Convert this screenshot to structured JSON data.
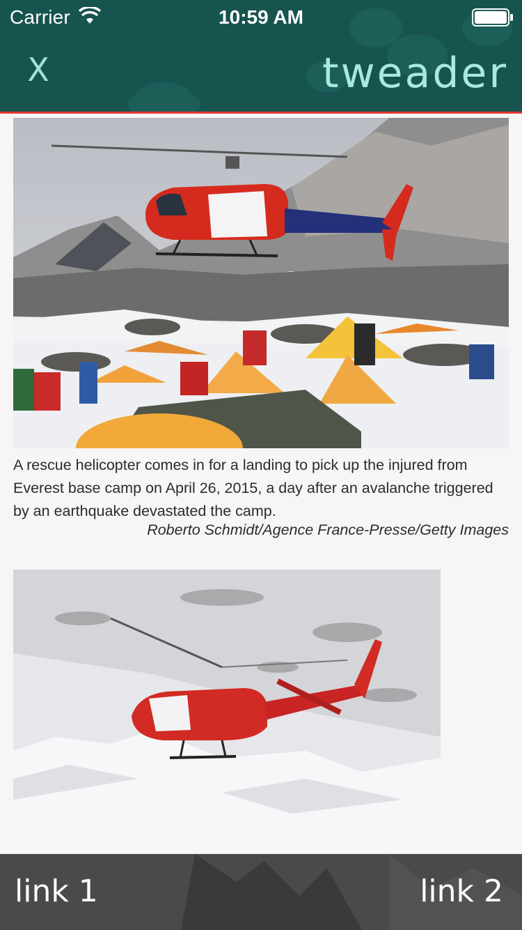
{
  "status_bar": {
    "carrier": "Carrier",
    "time": "10:59 AM"
  },
  "header": {
    "close_label": "X",
    "brand": "tweader",
    "background_color": "#17544f",
    "accent_line_color": "#e4352f"
  },
  "article": {
    "images": [
      {
        "name": "helicopter-base-camp-photo"
      },
      {
        "name": "helicopter-snow-photo"
      }
    ],
    "caption": "A rescue helicopter comes in for a landing to pick up the injured from Everest base camp on April 26, 2015, a day after an avalanche triggered by an earthquake devastated the camp.",
    "credit": "Roberto Schmidt/Agence France-Presse/Getty Images"
  },
  "footer": {
    "link1": "link 1",
    "link2": "link 2"
  }
}
